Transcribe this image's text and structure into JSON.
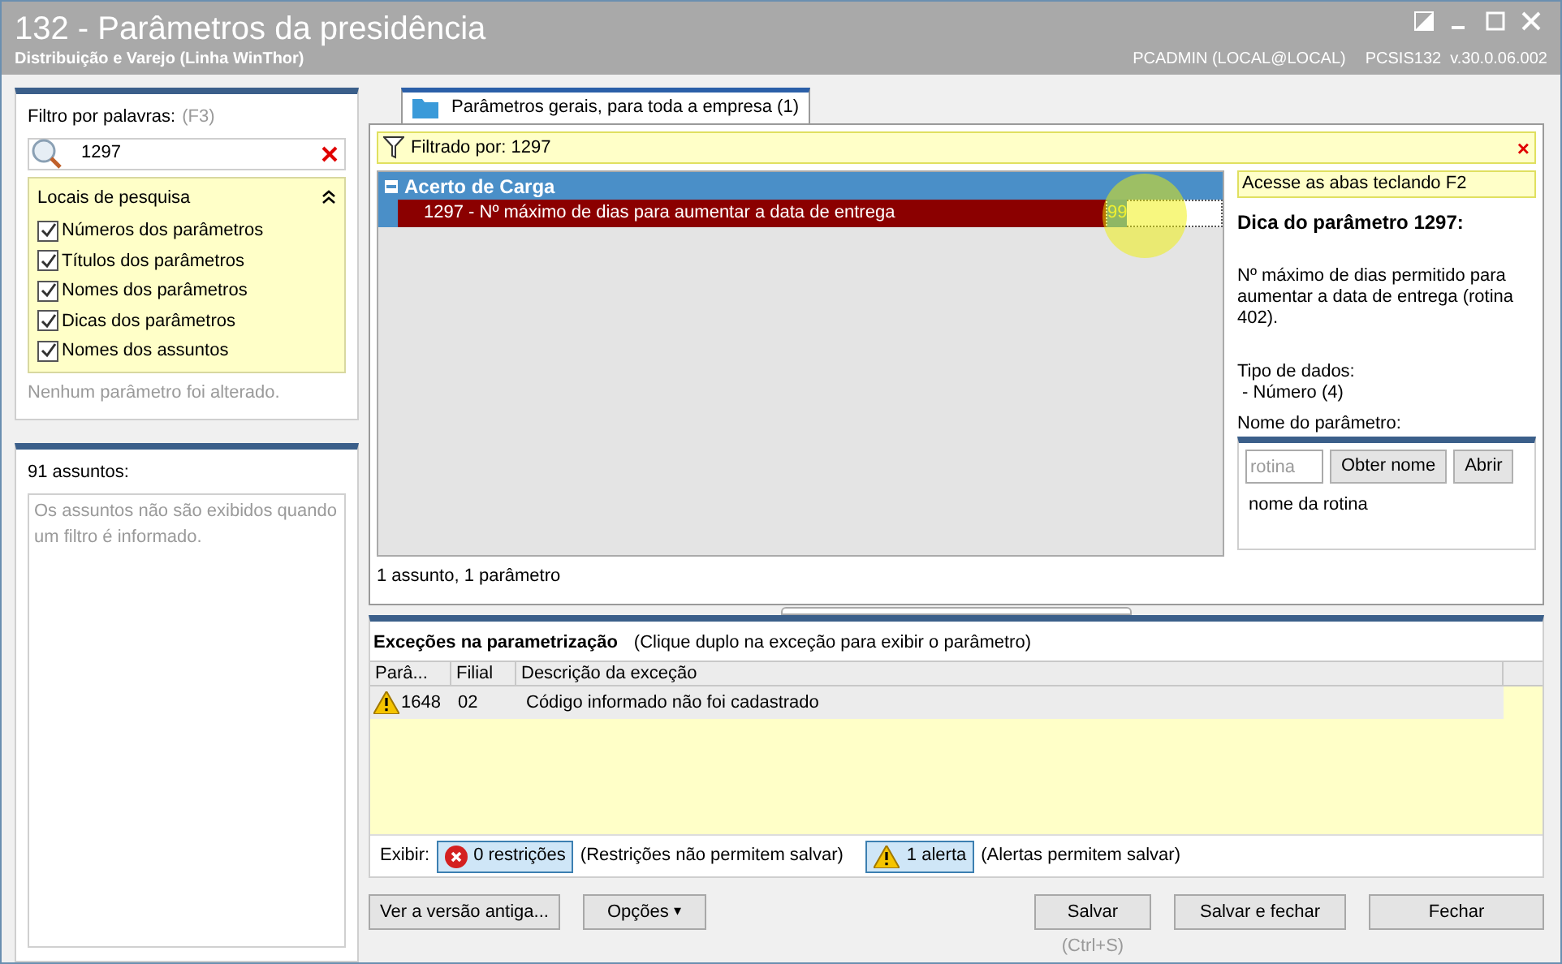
{
  "window": {
    "title": "132 - Parâmetros da presidência",
    "subtitle": "Distribuição e Varejo (Linha WinThor)",
    "user_info": "PCADMIN (LOCAL@LOCAL)",
    "version": "PCSIS132  v.30.0.06.002"
  },
  "filter": {
    "label": "Filtro por palavras:",
    "shortcut": "(F3)",
    "value": "1297"
  },
  "search_locations": {
    "title": "Locais de pesquisa",
    "expanded": true,
    "items": [
      {
        "label": "Números dos parâmetros",
        "checked": true
      },
      {
        "label": "Títulos dos parâmetros",
        "checked": true
      },
      {
        "label": "Nomes dos parâmetros",
        "checked": true
      },
      {
        "label": "Dicas dos parâmetros",
        "checked": true
      },
      {
        "label": "Nomes dos assuntos",
        "checked": true
      }
    ]
  },
  "changes_note": "Nenhum parâmetro foi alterado.",
  "subjects": {
    "title": "91 assuntos:",
    "note": "Os assuntos não são exibidos quando um filtro é informado."
  },
  "tabs": [
    {
      "label": "Parâmetros gerais, para toda a empresa  (1)",
      "selected": true
    }
  ],
  "filter_bar": {
    "text": "Filtrado por: 1297",
    "close": "×"
  },
  "tree": [
    {
      "label": "Acerto de Carga",
      "expanded": true,
      "children": [
        {
          "label": "1297 - Nº máximo de dias para aumentar a data de entrega",
          "value": "99",
          "selected": true
        }
      ]
    }
  ],
  "tip": {
    "hint": "Acesse as abas teclando F2",
    "title": "Dica do parâmetro 1297:",
    "description": "Nº máximo de dias permitido para aumentar a data de entrega (rotina 402).",
    "type_label": "Tipo de dados:",
    "type_value": " - Número (4)",
    "name_label": "Nome do parâmetro:"
  },
  "routine": {
    "placeholder": "rotina",
    "buttons": [
      "Obter nome",
      "Abrir"
    ],
    "name": "nome da rotina"
  },
  "status": "1 assunto, 1 parâmetro",
  "exceptions": {
    "title": "Exceções na parametrização",
    "hint": "(Clique duplo na exceção para exibir o parâmetro)",
    "columns": [
      "Parâ...",
      "Filial",
      "Descrição da exceção"
    ],
    "rows": [
      {
        "kind": "alert",
        "param": "1648",
        "branch": "02",
        "description": "Código informado não foi cadastrado"
      }
    ]
  },
  "show": {
    "label": "Exibir:",
    "filters": [
      {
        "kind": "restriction",
        "label": "0 restrições",
        "note": "(Restrições não permitem salvar)",
        "selected": true
      },
      {
        "kind": "alert",
        "label": "1 alerta",
        "note": "(Alertas permitem salvar)",
        "selected": true
      }
    ]
  },
  "buttons_left": [
    {
      "label": "Ver a versão antiga...",
      "kind": "plain"
    },
    {
      "label": "Opções",
      "kind": "menu",
      "caret": "▾"
    }
  ],
  "buttons_right": [
    {
      "label": "Salvar",
      "shortcut": "(Ctrl+S)"
    },
    {
      "label": "Salvar e fechar"
    },
    {
      "label": "Fechar"
    }
  ]
}
